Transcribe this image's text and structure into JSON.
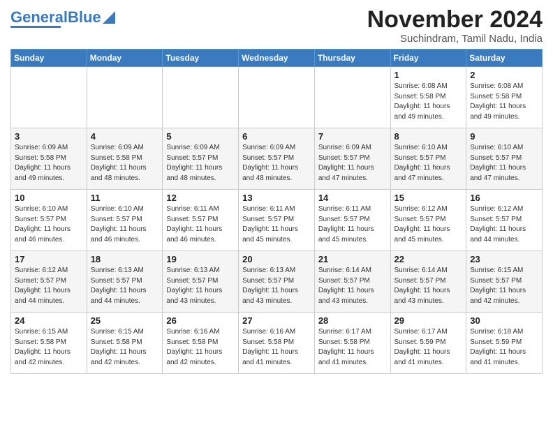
{
  "header": {
    "logo_general": "General",
    "logo_blue": "Blue",
    "month_title": "November 2024",
    "location": "Suchindram, Tamil Nadu, India"
  },
  "calendar": {
    "days_of_week": [
      "Sunday",
      "Monday",
      "Tuesday",
      "Wednesday",
      "Thursday",
      "Friday",
      "Saturday"
    ],
    "weeks": [
      [
        {
          "day": "",
          "info": ""
        },
        {
          "day": "",
          "info": ""
        },
        {
          "day": "",
          "info": ""
        },
        {
          "day": "",
          "info": ""
        },
        {
          "day": "",
          "info": ""
        },
        {
          "day": "1",
          "info": "Sunrise: 6:08 AM\nSunset: 5:58 PM\nDaylight: 11 hours\nand 49 minutes."
        },
        {
          "day": "2",
          "info": "Sunrise: 6:08 AM\nSunset: 5:58 PM\nDaylight: 11 hours\nand 49 minutes."
        }
      ],
      [
        {
          "day": "3",
          "info": "Sunrise: 6:09 AM\nSunset: 5:58 PM\nDaylight: 11 hours\nand 49 minutes."
        },
        {
          "day": "4",
          "info": "Sunrise: 6:09 AM\nSunset: 5:58 PM\nDaylight: 11 hours\nand 48 minutes."
        },
        {
          "day": "5",
          "info": "Sunrise: 6:09 AM\nSunset: 5:57 PM\nDaylight: 11 hours\nand 48 minutes."
        },
        {
          "day": "6",
          "info": "Sunrise: 6:09 AM\nSunset: 5:57 PM\nDaylight: 11 hours\nand 48 minutes."
        },
        {
          "day": "7",
          "info": "Sunrise: 6:09 AM\nSunset: 5:57 PM\nDaylight: 11 hours\nand 47 minutes."
        },
        {
          "day": "8",
          "info": "Sunrise: 6:10 AM\nSunset: 5:57 PM\nDaylight: 11 hours\nand 47 minutes."
        },
        {
          "day": "9",
          "info": "Sunrise: 6:10 AM\nSunset: 5:57 PM\nDaylight: 11 hours\nand 47 minutes."
        }
      ],
      [
        {
          "day": "10",
          "info": "Sunrise: 6:10 AM\nSunset: 5:57 PM\nDaylight: 11 hours\nand 46 minutes."
        },
        {
          "day": "11",
          "info": "Sunrise: 6:10 AM\nSunset: 5:57 PM\nDaylight: 11 hours\nand 46 minutes."
        },
        {
          "day": "12",
          "info": "Sunrise: 6:11 AM\nSunset: 5:57 PM\nDaylight: 11 hours\nand 46 minutes."
        },
        {
          "day": "13",
          "info": "Sunrise: 6:11 AM\nSunset: 5:57 PM\nDaylight: 11 hours\nand 45 minutes."
        },
        {
          "day": "14",
          "info": "Sunrise: 6:11 AM\nSunset: 5:57 PM\nDaylight: 11 hours\nand 45 minutes."
        },
        {
          "day": "15",
          "info": "Sunrise: 6:12 AM\nSunset: 5:57 PM\nDaylight: 11 hours\nand 45 minutes."
        },
        {
          "day": "16",
          "info": "Sunrise: 6:12 AM\nSunset: 5:57 PM\nDaylight: 11 hours\nand 44 minutes."
        }
      ],
      [
        {
          "day": "17",
          "info": "Sunrise: 6:12 AM\nSunset: 5:57 PM\nDaylight: 11 hours\nand 44 minutes."
        },
        {
          "day": "18",
          "info": "Sunrise: 6:13 AM\nSunset: 5:57 PM\nDaylight: 11 hours\nand 44 minutes."
        },
        {
          "day": "19",
          "info": "Sunrise: 6:13 AM\nSunset: 5:57 PM\nDaylight: 11 hours\nand 43 minutes."
        },
        {
          "day": "20",
          "info": "Sunrise: 6:13 AM\nSunset: 5:57 PM\nDaylight: 11 hours\nand 43 minutes."
        },
        {
          "day": "21",
          "info": "Sunrise: 6:14 AM\nSunset: 5:57 PM\nDaylight: 11 hours\nand 43 minutes."
        },
        {
          "day": "22",
          "info": "Sunrise: 6:14 AM\nSunset: 5:57 PM\nDaylight: 11 hours\nand 43 minutes."
        },
        {
          "day": "23",
          "info": "Sunrise: 6:15 AM\nSunset: 5:57 PM\nDaylight: 11 hours\nand 42 minutes."
        }
      ],
      [
        {
          "day": "24",
          "info": "Sunrise: 6:15 AM\nSunset: 5:58 PM\nDaylight: 11 hours\nand 42 minutes."
        },
        {
          "day": "25",
          "info": "Sunrise: 6:15 AM\nSunset: 5:58 PM\nDaylight: 11 hours\nand 42 minutes."
        },
        {
          "day": "26",
          "info": "Sunrise: 6:16 AM\nSunset: 5:58 PM\nDaylight: 11 hours\nand 42 minutes."
        },
        {
          "day": "27",
          "info": "Sunrise: 6:16 AM\nSunset: 5:58 PM\nDaylight: 11 hours\nand 41 minutes."
        },
        {
          "day": "28",
          "info": "Sunrise: 6:17 AM\nSunset: 5:58 PM\nDaylight: 11 hours\nand 41 minutes."
        },
        {
          "day": "29",
          "info": "Sunrise: 6:17 AM\nSunset: 5:59 PM\nDaylight: 11 hours\nand 41 minutes."
        },
        {
          "day": "30",
          "info": "Sunrise: 6:18 AM\nSunset: 5:59 PM\nDaylight: 11 hours\nand 41 minutes."
        }
      ]
    ]
  }
}
